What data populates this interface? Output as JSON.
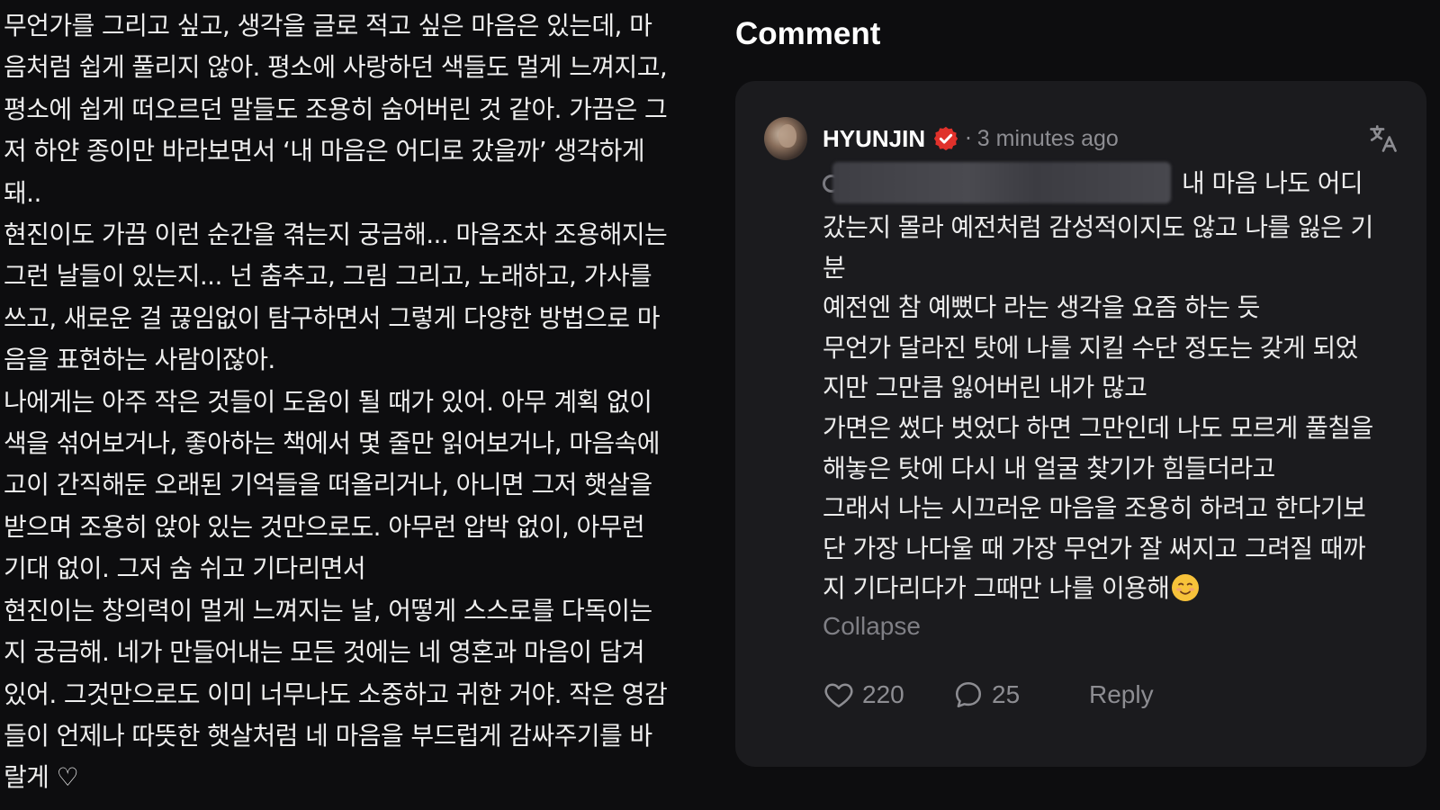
{
  "letter": {
    "lines": [
      "무언가를 그리고 싶고, 생각을 글로 적고 싶은 마음은 있는데, 마",
      "음처럼 쉽게 풀리지 않아. 평소에 사랑하던 색들도 멀게 느껴지고,",
      "평소에 쉽게 떠오르던 말들도 조용히 숨어버린 것 같아. 가끔은 그",
      "저 하얀 종이만 바라보면서 ‘내 마음은 어디로 갔을까’ 생각하게",
      "돼..",
      "현진이도 가끔 이런 순간을 겪는지 궁금해... 마음조차 조용해지는",
      "그런 날들이 있는지... 넌 춤추고, 그림 그리고, 노래하고, 가사를",
      "쓰고, 새로운 걸 끊임없이 탐구하면서 그렇게 다양한 방법으로 마",
      "음을 표현하는 사람이잖아.",
      "나에게는 아주 작은 것들이 도움이 될 때가 있어. 아무 계획 없이",
      "색을 섞어보거나, 좋아하는 책에서 몇 줄만 읽어보거나, 마음속에",
      "고이 간직해둔 오래된 기억들을 떠올리거나, 아니면 그저 햇살을",
      "받으며 조용히 앉아 있는 것만으로도. 아무런 압박 없이, 아무런",
      "기대 없이. 그저 숨 쉬고 기다리면서",
      "현진이는 창의력이 멀게 느껴지는 날, 어떻게 스스로를 다독이는",
      "지 궁금해. 네가 만들어내는 모든 것에는 네 영혼과 마음이 담겨",
      "있어. 그것만으로도 이미 너무나도 소중하고 귀한 거야. 작은 영감",
      "들이 언제나 따뜻한 햇살처럼 네 마음을 부드럽게 감싸주기를 바",
      "랄게 ♡"
    ]
  },
  "comment_section": {
    "heading": "Comment",
    "comment": {
      "author": "HYUNJIN",
      "separator": "·",
      "timestamp": "3 minutes ago",
      "first_line": "내 마음 나도 어디",
      "lines": [
        "갔는지 몰라 예전처럼 감성적이지도 않고 나를 잃은 기",
        "분",
        "예전엔 참 예뻤다 라는 생각을 요즘 하는 듯",
        "무언가 달라진 탓에 나를 지킬 수단 정도는 갖게 되었",
        "지만 그만큼 잃어버린 내가 많고",
        "가면은 썼다 벗었다 하면 그만인데 나도 모르게 풀칠을",
        "해놓은 탓에 다시 내 얼굴 찾기가 힘들더라고",
        "그래서 나는 시끄러운 마음을 조용히 하려고 한다기보",
        "단 가장 나다울 때 가장 무언가 잘 써지고 그려질 때까"
      ],
      "last_line": "지 기다리다가 그때만 나를 이용해",
      "collapse_label": "Collapse",
      "likes": "220",
      "replies_count": "25",
      "reply_label": "Reply",
      "icons": {
        "verified": "verified-badge-icon",
        "translate": "translate-icon",
        "like": "heart-icon",
        "comments": "speech-bubble-icon",
        "emoji": "smiling-face-emoji"
      },
      "colors": {
        "verified": "#e0312b",
        "muted": "#8d8d92"
      }
    }
  }
}
